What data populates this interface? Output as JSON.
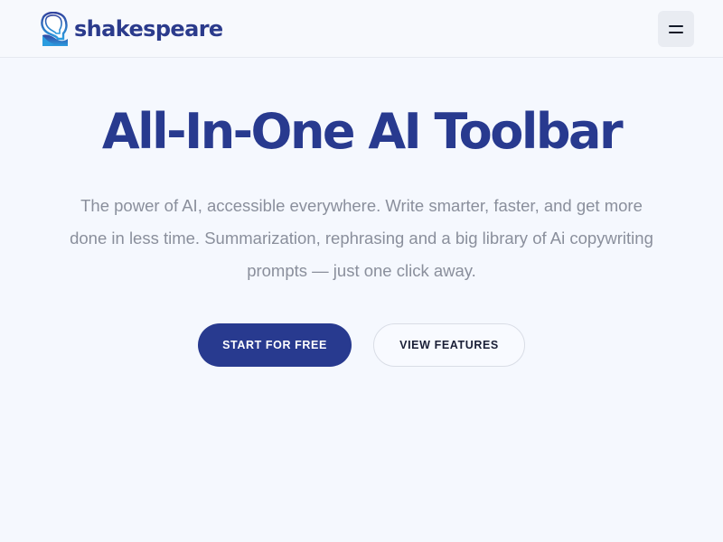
{
  "header": {
    "logo_text": "shakespeare",
    "logo_icon": "shakespeare-head-logo",
    "menu_icon": "hamburger-menu-icon"
  },
  "hero": {
    "title": "All-In-One AI Toolbar",
    "description": "The power of AI, accessible everywhere. Write smarter, faster, and get more done in less time. Summarization, rephrasing and a big library of Ai copywriting prompts — just one click away."
  },
  "cta": {
    "primary_label": "START FOR FREE",
    "secondary_label": "VIEW FEATURES"
  },
  "colors": {
    "brand": "#283a8f",
    "background": "#f5f8fe",
    "body_text": "#8a8f9c",
    "logo_gradient_top": "#3344a0",
    "logo_gradient_bottom": "#2d9bdc"
  }
}
